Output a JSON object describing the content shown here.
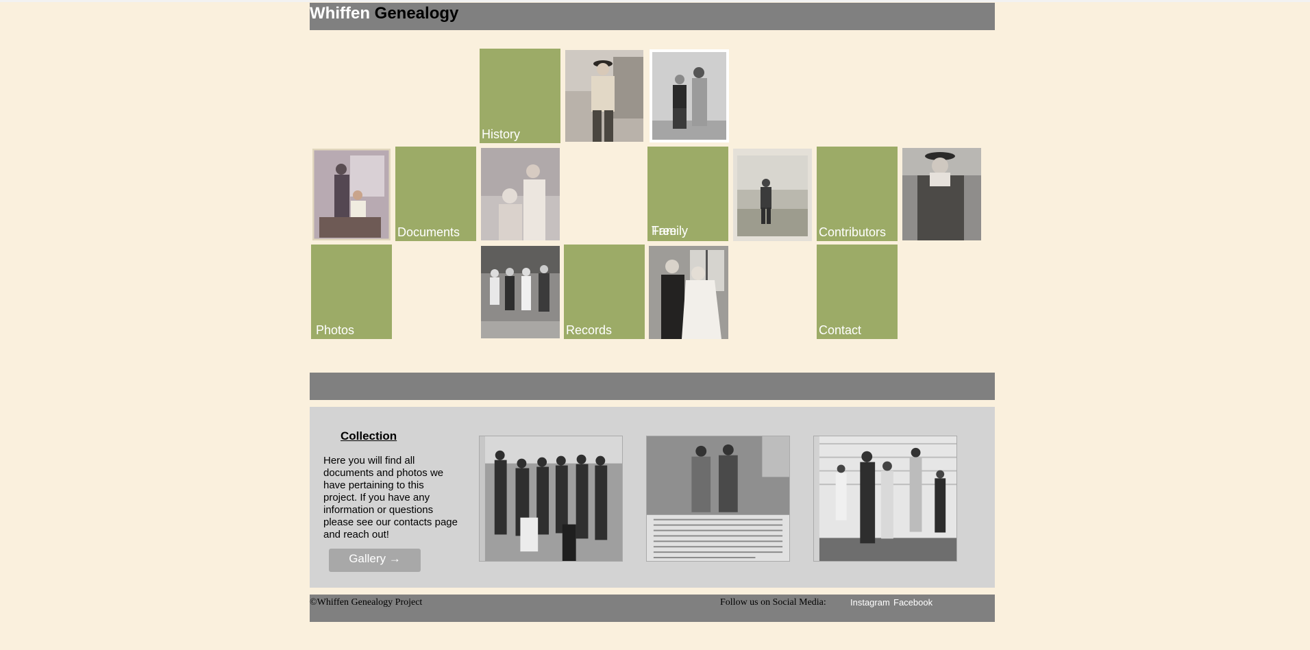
{
  "header": {
    "brand_first": "Whiffen",
    "brand_second": "Genealogy"
  },
  "tiles": {
    "history": "History",
    "documents": "Documents",
    "family_tree_line1": "Family",
    "family_tree_line2": "Tree",
    "contributors": "Contributors",
    "photos": "Photos",
    "records": "Records",
    "contact": "Contact"
  },
  "collection": {
    "title": "Collection",
    "text": "Here you will find all documents and photos we have pertaining to this project. If you have any information or questions please see our contacts page and reach out!",
    "button": "Gallery →"
  },
  "footer": {
    "copyright": "©Whiffen Genealogy Project",
    "follow": "Follow us on Social Media:",
    "instagram": "Instagram",
    "facebook": "Facebook"
  },
  "colors": {
    "background": "#faf0dd",
    "bar": "#808080",
    "tile": "#9cab67",
    "panel": "#d3d3d3"
  }
}
